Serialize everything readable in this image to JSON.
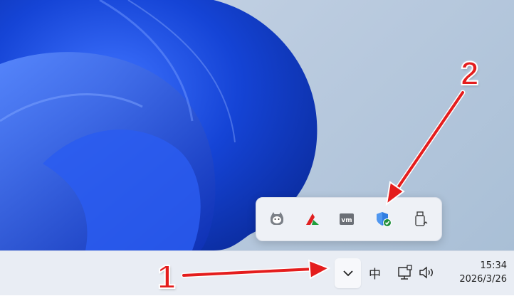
{
  "taskbar": {
    "ime_indicator": "中",
    "clock_time": "15:34",
    "clock_date": "2026/3/26",
    "chevron_icon": "chevron-up-icon",
    "network_icon": "network-wired-icon",
    "volume_icon": "speaker-volume-icon"
  },
  "tray_overflow": {
    "items": [
      {
        "icon": "cat-app-icon"
      },
      {
        "icon": "red-green-a-app-icon"
      },
      {
        "icon": "vmware-icon",
        "text": "vm"
      },
      {
        "icon": "windows-security-shield-icon"
      },
      {
        "icon": "usb-safely-remove-icon"
      }
    ]
  },
  "annotations": {
    "label_1": "1",
    "label_2": "2",
    "arrow_color": "#e41d1d"
  }
}
